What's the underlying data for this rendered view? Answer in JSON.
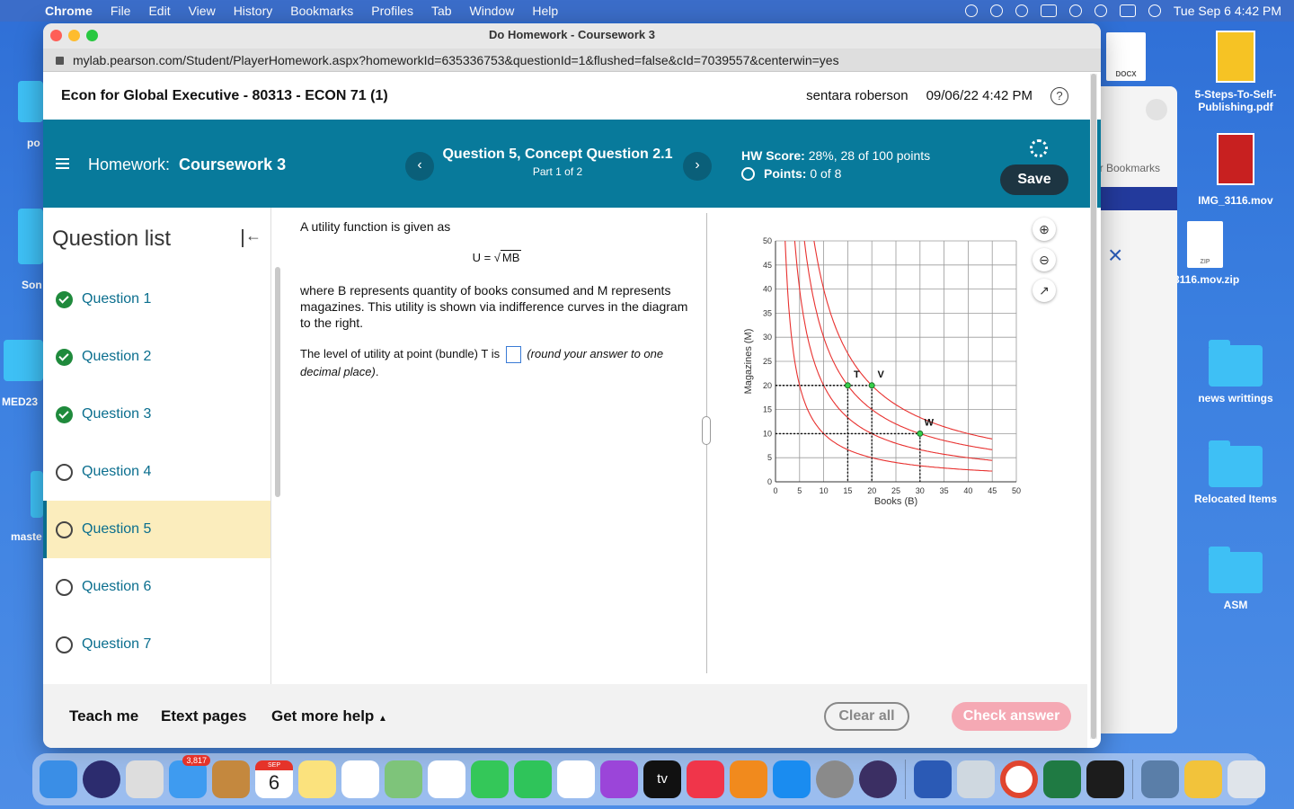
{
  "menubar": {
    "app": "Chrome",
    "items": [
      "File",
      "Edit",
      "View",
      "History",
      "Bookmarks",
      "Profiles",
      "Tab",
      "Window",
      "Help"
    ],
    "datetime": "Tue Sep 6  4:42 PM"
  },
  "desktop": {
    "left_labels": [
      "po",
      "Son",
      "MED23",
      "maste"
    ],
    "right_items": [
      "5-Steps-To-Self-Publishing.pdf",
      "IMG_3116.mov",
      "3116.mov.zip",
      "news writtings",
      "Relocated Items",
      "ASM"
    ],
    "docx_label": "DOCX",
    "zip_label": "ZIP"
  },
  "bgwindow": {
    "bookmarks": "er Bookmarks"
  },
  "browser": {
    "title": "Do Homework - Coursework 3",
    "url": "mylab.pearson.com/Student/PlayerHomework.aspx?homeworkId=635336753&questionId=1&flushed=false&cId=7039557&centerwin=yes"
  },
  "course": {
    "title": "Econ for Global Executive - 80313 - ECON 71 (1)",
    "user": "sentara roberson",
    "datetime": "09/06/22 4:42 PM",
    "help": "?"
  },
  "homework": {
    "label": "Homework:",
    "name": "Coursework 3",
    "question_title": "Question 5, Concept Question 2.1",
    "part": "Part 1 of 2",
    "hw_score_label": "HW Score:",
    "hw_score": "28%, 28 of 100 points",
    "points_label": "Points:",
    "points": "0 of 8",
    "save": "Save",
    "prev": "‹",
    "next": "›"
  },
  "question_list": {
    "heading": "Question list",
    "items": [
      {
        "label": "Question 1",
        "status": "done"
      },
      {
        "label": "Question 2",
        "status": "done"
      },
      {
        "label": "Question 3",
        "status": "done"
      },
      {
        "label": "Question 4",
        "status": "open"
      },
      {
        "label": "Question 5",
        "status": "active"
      },
      {
        "label": "Question 6",
        "status": "open"
      },
      {
        "label": "Question 7",
        "status": "open"
      }
    ]
  },
  "question": {
    "intro": "A utility function is given as",
    "formula_lhs": "U  =",
    "formula_radicand": "MB",
    "body": "where B represents quantity of books consumed and M represents magazines. This utility is shown via indifference curves in the diagram to the right.",
    "prompt_pre": "The level of utility at point (bundle) T is",
    "prompt_post": "(round your answer to one decimal place)",
    "prompt_end": "."
  },
  "chart_data": {
    "type": "line",
    "xlabel": "Books (B)",
    "ylabel": "Magazines (M)",
    "xlim": [
      0,
      50
    ],
    "ylim": [
      0,
      50
    ],
    "xticks": [
      0,
      5,
      10,
      15,
      20,
      25,
      30,
      35,
      40,
      45,
      50
    ],
    "yticks": [
      0,
      5,
      10,
      15,
      20,
      25,
      30,
      35,
      40,
      45,
      50
    ],
    "grid": true,
    "curve_color": "#e8312f",
    "series": [
      {
        "formula": "M = 100/B",
        "utility": 10
      },
      {
        "formula": "M = 200/B",
        "utility": 14.14
      },
      {
        "formula": "M = 300/B",
        "utility": 17.32
      },
      {
        "formula": "M = 400/B",
        "utility": 20
      }
    ],
    "points": [
      {
        "label": "T",
        "x": 15,
        "y": 20
      },
      {
        "label": "V",
        "x": 20,
        "y": 20
      },
      {
        "label": "W",
        "x": 30,
        "y": 10
      }
    ]
  },
  "footer": {
    "teach": "Teach me",
    "etext": "Etext pages",
    "more": "Get more help",
    "clear": "Clear all",
    "check": "Check answer"
  },
  "dock": {
    "mail_badge": "3,817",
    "cal_month": "SEP",
    "cal_day": "6",
    "tv": "tv"
  }
}
